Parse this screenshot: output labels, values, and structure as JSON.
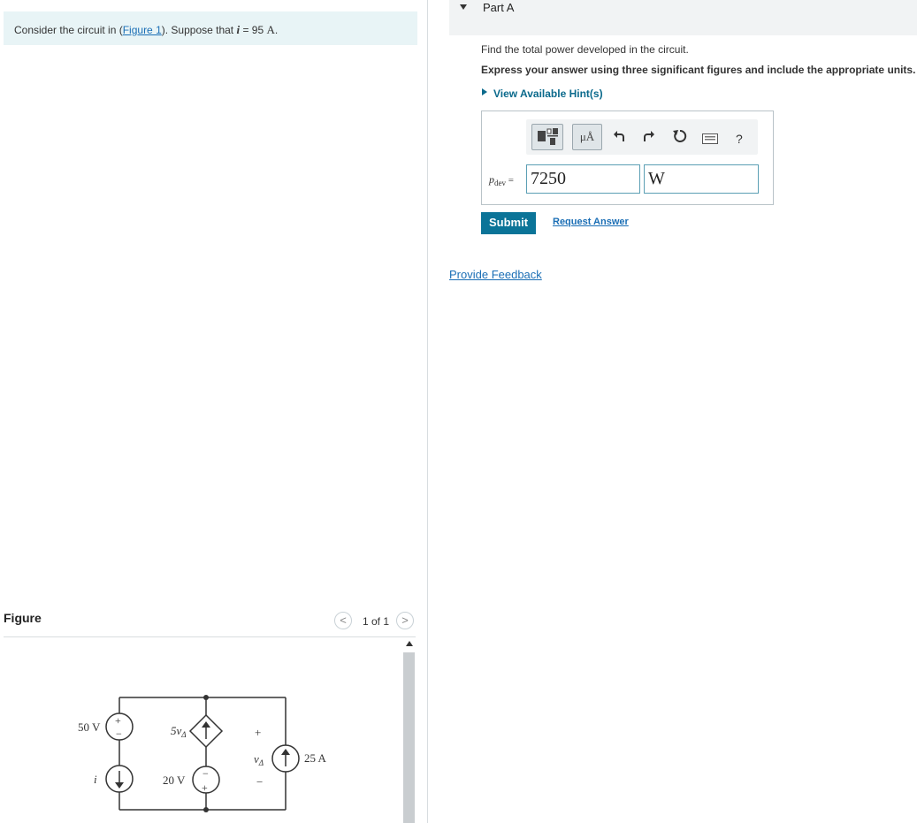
{
  "problem": {
    "intro_prefix": "Consider the circuit in (",
    "figure_link": "Figure 1",
    "intro_mid": "). Suppose that ",
    "var": "i",
    "eq": " = 95 ",
    "unit": "A",
    "end": "."
  },
  "part_a": {
    "title": "Part A",
    "question": "Find the total power developed in the circuit.",
    "instruction": "Express your answer using three significant figures and include the appropriate units.",
    "hint_link": "View Available Hint(s)",
    "toolbar": {
      "units_button": "μÅ",
      "help": "?"
    },
    "answer_label_var": "p",
    "answer_label_sub": "dev",
    "answer_label_eq": " =",
    "answer_value": "7250",
    "answer_unit": "W",
    "submit": "Submit",
    "request_answer": "Request Answer"
  },
  "feedback_link": "Provide Feedback",
  "figure": {
    "label": "Figure",
    "pager": "1 of 1",
    "prev": "<",
    "next": ">",
    "circuit": {
      "v50": "50 V",
      "dep": "5v",
      "dep_sub": "Δ",
      "vdelta": "v",
      "vdelta_sub": "Δ",
      "i25": "25 A",
      "i_label": "i",
      "v20": "20 V",
      "plus": "+",
      "minus": "−"
    }
  },
  "colors": {
    "accent": "#0b7498",
    "link": "#1a6eb5",
    "intro_bg": "#e8f4f6"
  }
}
